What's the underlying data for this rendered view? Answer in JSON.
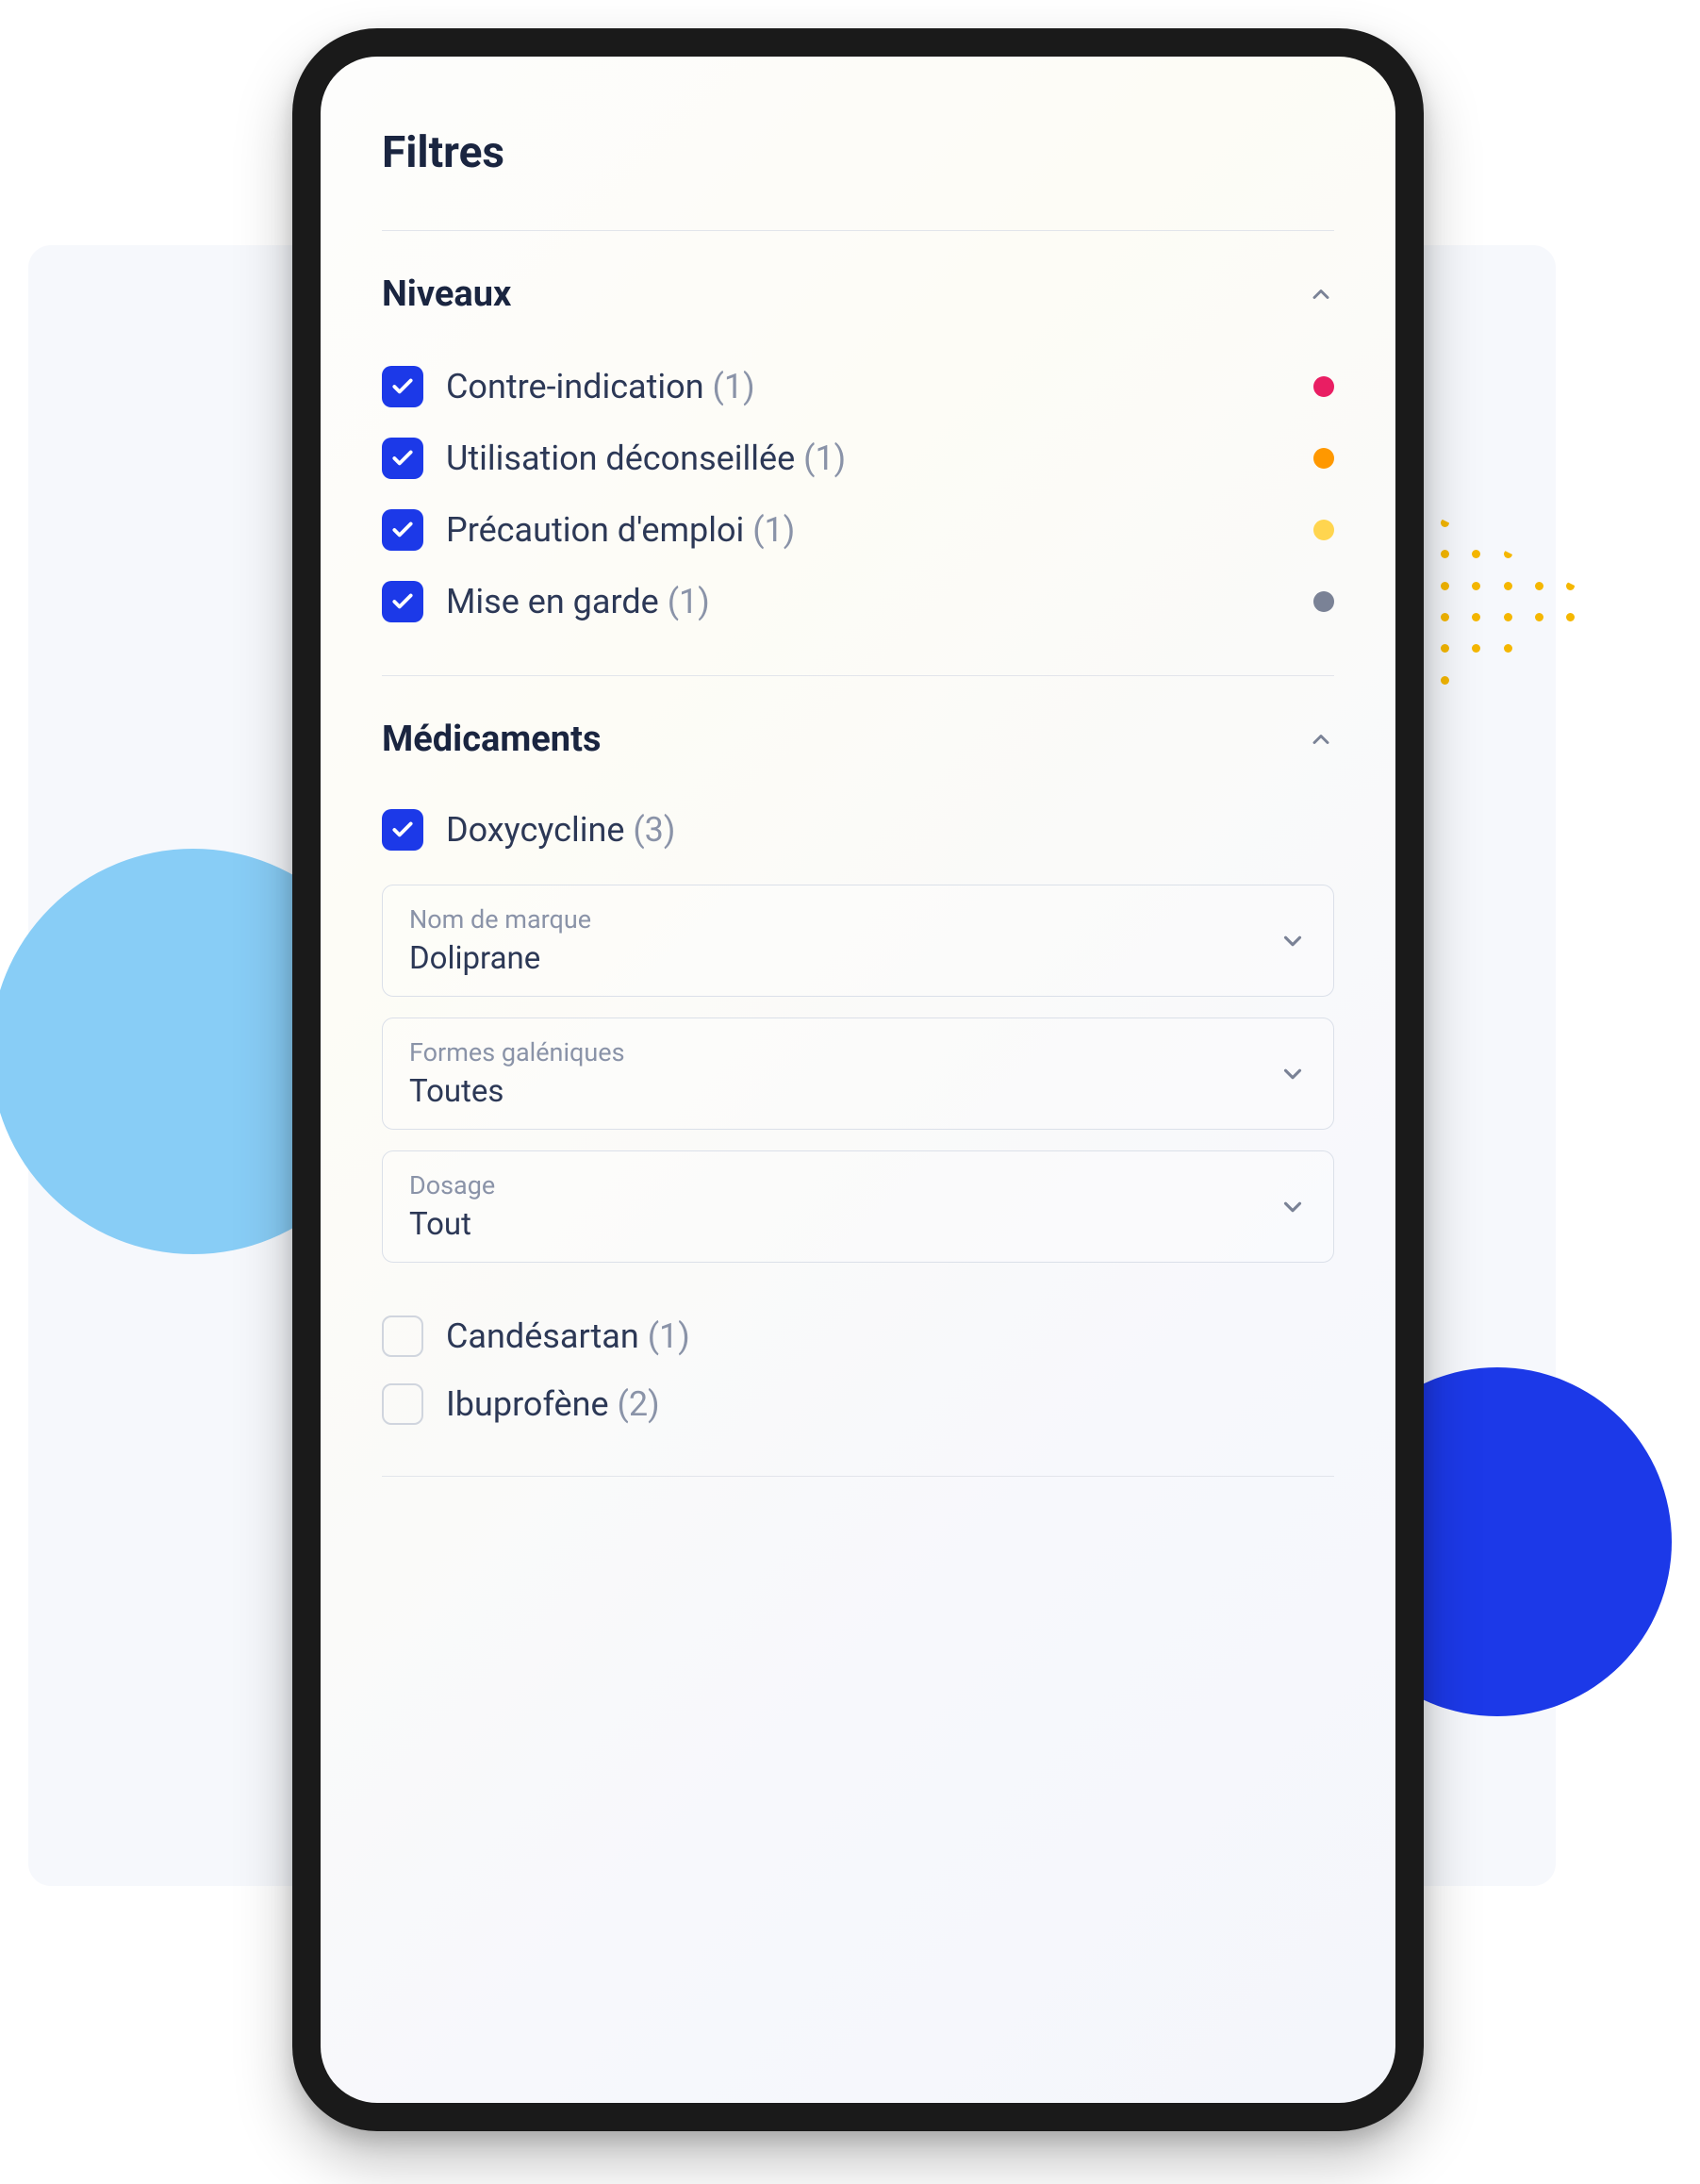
{
  "panel": {
    "title": "Filtres"
  },
  "sections": {
    "levels": {
      "title": "Niveaux",
      "items": [
        {
          "label": "Contre-indication",
          "count": "(1)",
          "checked": true,
          "dotColor": "pink"
        },
        {
          "label": "Utilisation déconseillée",
          "count": "(1)",
          "checked": true,
          "dotColor": "orange"
        },
        {
          "label": "Précaution d'emploi",
          "count": "(1)",
          "checked": true,
          "dotColor": "yellow"
        },
        {
          "label": "Mise en garde",
          "count": "(1)",
          "checked": true,
          "dotColor": "grey"
        }
      ]
    },
    "medications": {
      "title": "Médicaments",
      "primary": {
        "label": "Doxycycline",
        "count": "(3)",
        "checked": true
      },
      "selects": [
        {
          "label": "Nom de marque",
          "value": "Doliprane"
        },
        {
          "label": "Formes galéniques",
          "value": "Toutes"
        },
        {
          "label": "Dosage",
          "value": "Tout"
        }
      ],
      "extras": [
        {
          "label": "Candésartan",
          "count": "(1)",
          "checked": false
        },
        {
          "label": "Ibuprofène",
          "count": "(2)",
          "checked": false
        }
      ]
    }
  }
}
